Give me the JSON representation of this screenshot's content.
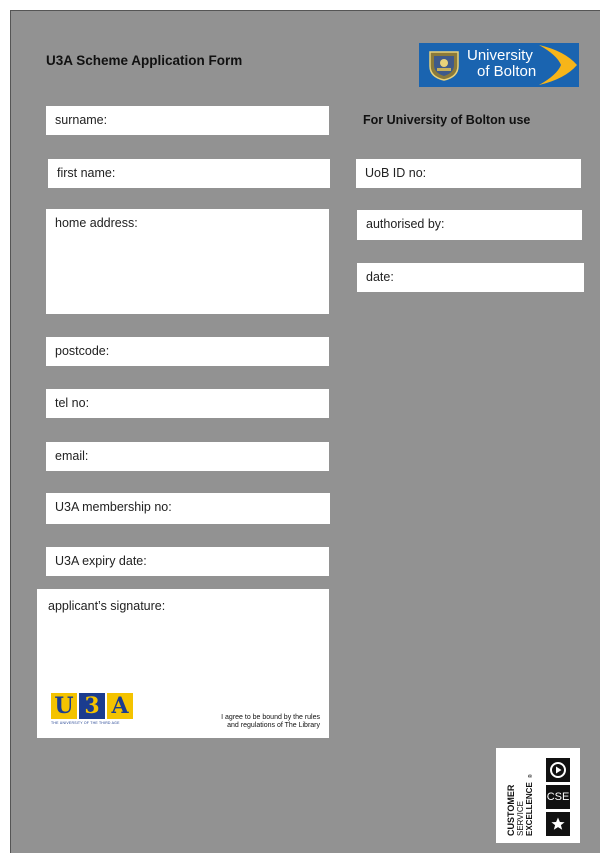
{
  "form": {
    "title": "U3A Scheme Application Form"
  },
  "logo": {
    "line1": "University",
    "line2": "of Bolton",
    "brand_color": "#1a64b0",
    "accent_color": "#f7b519"
  },
  "applicant_fields": [
    {
      "label": "surname:"
    },
    {
      "label": "first name:"
    },
    {
      "label": "home address:"
    },
    {
      "label": "postcode:"
    },
    {
      "label": "tel no:"
    },
    {
      "label": "email:"
    },
    {
      "label": "U3A membership no:"
    },
    {
      "label": "U3A expiry date:"
    }
  ],
  "uob_use": {
    "heading": "For University of Bolton use",
    "fields": [
      {
        "label": "UoB ID no:"
      },
      {
        "label": "authorised by:"
      },
      {
        "label": "date:"
      }
    ]
  },
  "signature": {
    "label": "applicant’s signature:",
    "agreement_line1": "I agree to be bound by the rules",
    "agreement_line2": "and regulations of The Library"
  },
  "u3a_logo": {
    "letters": [
      "U",
      "3",
      "A"
    ],
    "tagline": "THE UNIVERSITY OF THE THIRD AGE"
  },
  "cse_badge": {
    "line1": "CUSTOMER",
    "line2": "SERVICE",
    "line3": "EXCELLENCE",
    "mark": "®",
    "icon_label": "CSE",
    "icons": [
      "play-icon",
      "cse-icon",
      "star-icon"
    ]
  }
}
